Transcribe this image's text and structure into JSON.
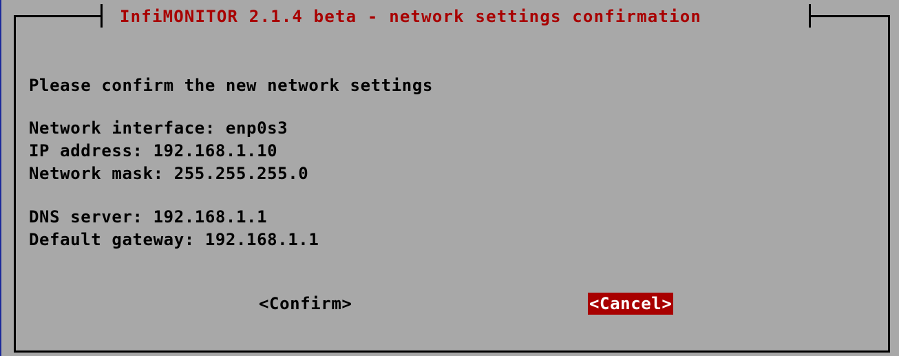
{
  "dialog": {
    "title": "InfiMONITOR 2.1.4 beta - network settings confirmation",
    "intro": "Please confirm the new network settings",
    "lines": {
      "interface": "Network interface: enp0s3",
      "ip": "IP address: 192.168.1.10",
      "mask": "Network mask: 255.255.255.0",
      "dns": "DNS server: 192.168.1.1",
      "gateway": "Default gateway: 192.168.1.1"
    },
    "buttons": {
      "confirm": "<Confirm>",
      "cancel": "<Cancel>"
    }
  },
  "colors": {
    "background": "#a8a8a8",
    "title": "#a80000",
    "selected_button_bg": "#a80000",
    "selected_button_text": "#ffffff",
    "outer_border": "#1c2a9a"
  }
}
